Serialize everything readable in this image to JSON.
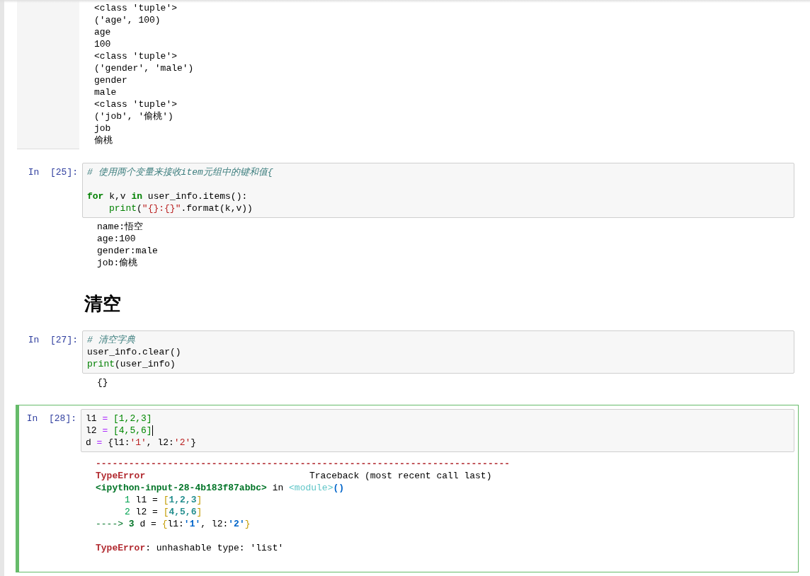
{
  "cells": [
    {
      "kind": "output_tail",
      "output": [
        "<class 'tuple'>",
        "('age', 100)",
        "age",
        "100",
        "<class 'tuple'>",
        "('gender', 'male')",
        "gender",
        "male",
        "<class 'tuple'>",
        "('job', '偷桃')",
        "job",
        "偷桃"
      ]
    },
    {
      "kind": "code",
      "prompt": "In  [25]:",
      "selected": false,
      "code": [
        {
          "kind": "line",
          "cursor": false,
          "tokens": [
            {
              "kind": "comment",
              "text": "# 使用两个变量来接收item元组中的键和值{"
            }
          ]
        },
        {
          "kind": "blank",
          "cursor": false
        },
        {
          "kind": "line",
          "cursor": false,
          "tokens": [
            {
              "kind": "keyword",
              "text": "for"
            },
            {
              "kind": "plain",
              "text": " k,v "
            },
            {
              "kind": "keyword",
              "text": "in"
            },
            {
              "kind": "plain",
              "text": " user_info.items():"
            }
          ]
        },
        {
          "kind": "indented",
          "cursor": false,
          "tokens": [
            {
              "kind": "builtin",
              "text": "print"
            },
            {
              "kind": "plain",
              "text": "("
            },
            {
              "kind": "string",
              "text": "\"{}:{}\""
            },
            {
              "kind": "plain",
              "text": ".format(k,v))"
            }
          ]
        }
      ],
      "output": [
        "name:悟空",
        "age:100",
        "gender:male",
        "job:偷桃"
      ]
    },
    {
      "kind": "markdown",
      "heading": "清空"
    },
    {
      "kind": "code",
      "prompt": "In  [27]:",
      "selected": false,
      "code": [
        {
          "kind": "line",
          "cursor": false,
          "tokens": [
            {
              "kind": "comment",
              "text": "# 清空字典"
            }
          ]
        },
        {
          "kind": "line",
          "cursor": false,
          "tokens": [
            {
              "kind": "plain",
              "text": "user_info.clear()"
            }
          ]
        },
        {
          "kind": "line",
          "cursor": false,
          "tokens": [
            {
              "kind": "builtin",
              "text": "print"
            },
            {
              "kind": "plain",
              "text": "(user_info)"
            }
          ]
        }
      ],
      "output": [
        "{}"
      ]
    },
    {
      "kind": "code",
      "prompt": "In  [28]:",
      "selected": true,
      "code": [
        {
          "kind": "line",
          "cursor": false,
          "tokens": [
            {
              "kind": "plain",
              "text": "l1 "
            },
            {
              "kind": "operator",
              "text": "="
            },
            {
              "kind": "number",
              "text": " [1,2,3]"
            }
          ]
        },
        {
          "kind": "line",
          "cursor": true,
          "tokens": [
            {
              "kind": "plain",
              "text": "l2 "
            },
            {
              "kind": "operator",
              "text": "="
            },
            {
              "kind": "number",
              "text": " [4,5,6]"
            }
          ]
        },
        {
          "kind": "line",
          "cursor": false,
          "tokens": [
            {
              "kind": "plain",
              "text": "d "
            },
            {
              "kind": "operator",
              "text": "="
            },
            {
              "kind": "plain",
              "text": " {l1:"
            },
            {
              "kind": "string",
              "text": "'1'"
            },
            {
              "kind": "plain",
              "text": ", l2:"
            },
            {
              "kind": "string",
              "text": "'2'"
            },
            {
              "kind": "plain",
              "text": "}"
            }
          ]
        }
      ],
      "traceback": [
        {
          "kind": "plain",
          "tokens": [
            {
              "kind": "err",
              "text": "---------------------------------------------------------------------------"
            }
          ]
        },
        {
          "kind": "header",
          "tokens": [
            {
              "kind": "err",
              "text": "TypeError"
            },
            {
              "kind": "plain",
              "text": "Traceback (most recent call last)"
            }
          ]
        },
        {
          "kind": "plain",
          "tokens": [
            {
              "kind": "loc",
              "text": "<ipython-input-28-4b183f87abbc>"
            },
            {
              "kind": "plain",
              "text": " in "
            },
            {
              "kind": "module",
              "text": "<module>"
            },
            {
              "kind": "paren",
              "text": "()"
            }
          ]
        },
        {
          "kind": "source",
          "tokens": [
            {
              "kind": "lineno",
              "text": "1"
            },
            {
              "kind": "plain",
              "text": " l1 = "
            },
            {
              "kind": "bracket",
              "text": "["
            },
            {
              "kind": "digit",
              "text": "1,2,3"
            },
            {
              "kind": "bracket",
              "text": "]"
            }
          ]
        },
        {
          "kind": "source",
          "tokens": [
            {
              "kind": "lineno",
              "text": "2"
            },
            {
              "kind": "plain",
              "text": " l2 = "
            },
            {
              "kind": "bracket",
              "text": "["
            },
            {
              "kind": "digit",
              "text": "4,5,6"
            },
            {
              "kind": "bracket",
              "text": "]"
            }
          ]
        },
        {
          "kind": "plain",
          "tokens": [
            {
              "kind": "arrow",
              "text": "---->"
            },
            {
              "kind": "arrowno",
              "text": " 3"
            },
            {
              "kind": "plain",
              "text": " d = "
            },
            {
              "kind": "bracket",
              "text": "{"
            },
            {
              "kind": "plain",
              "text": "l1:"
            },
            {
              "kind": "quoted",
              "text": "'1'"
            },
            {
              "kind": "plain",
              "text": ", l2:"
            },
            {
              "kind": "quoted",
              "text": "'2'"
            },
            {
              "kind": "bracket",
              "text": "}"
            }
          ]
        },
        {
          "kind": "blank"
        },
        {
          "kind": "plain",
          "tokens": [
            {
              "kind": "err",
              "text": "TypeError"
            },
            {
              "kind": "plain",
              "text": ": unhashable type: 'list'"
            }
          ]
        }
      ]
    }
  ]
}
